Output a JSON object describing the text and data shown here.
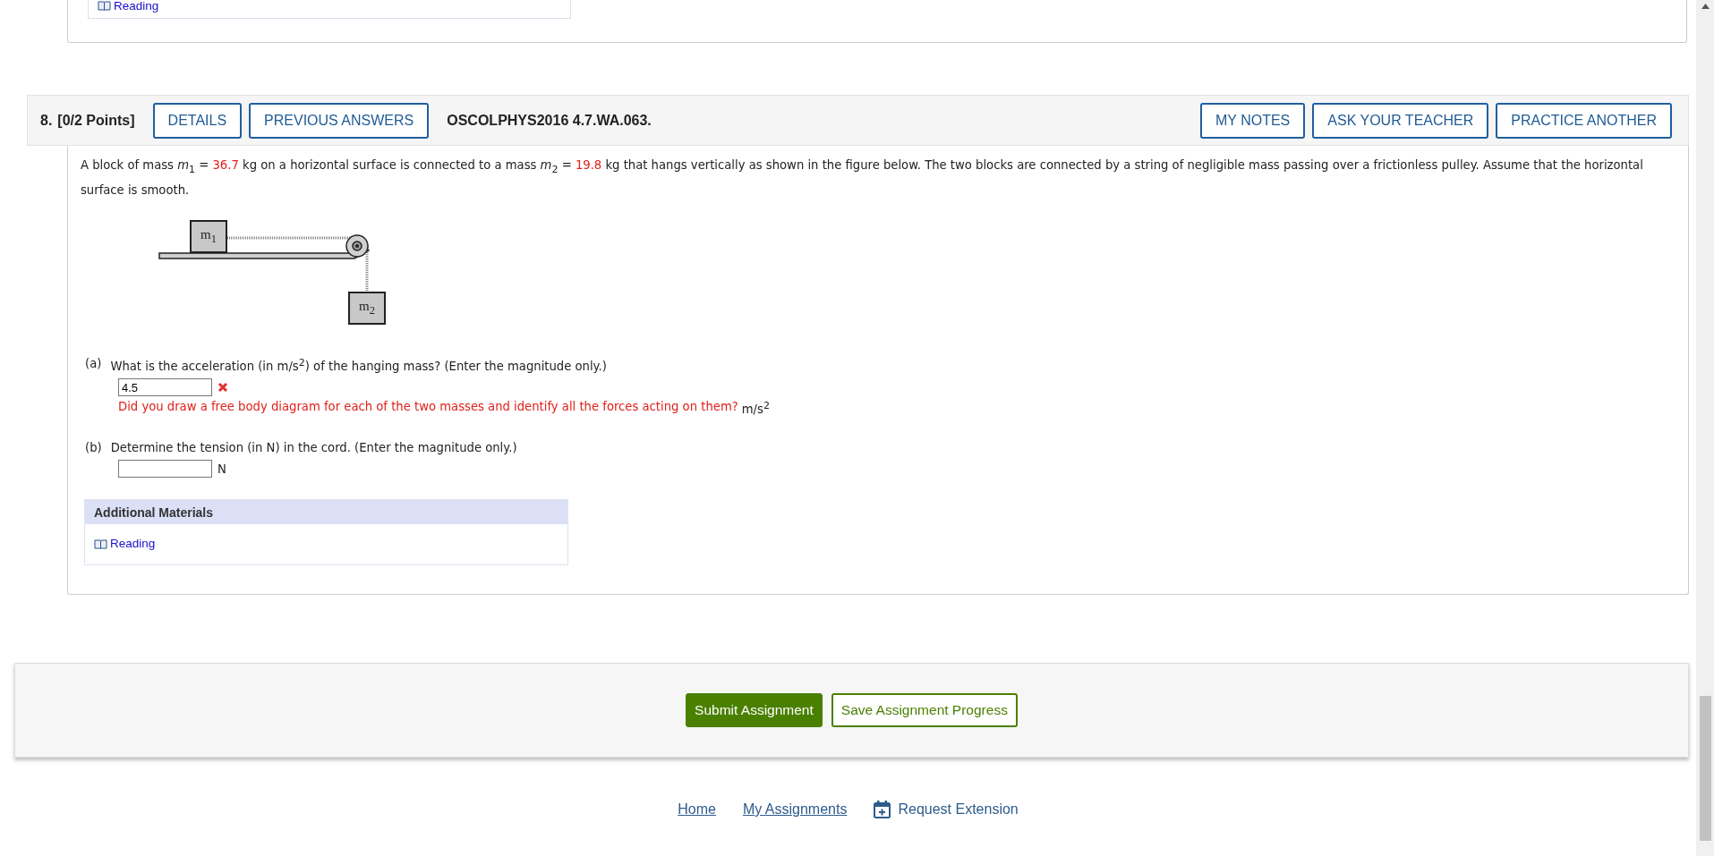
{
  "previous_question": {
    "materials_link": "Reading"
  },
  "question": {
    "number": "8.",
    "points": "[0/2 Points]",
    "buttons_left": [
      "DETAILS",
      "PREVIOUS ANSWERS"
    ],
    "code": "OSCOLPHYS2016 4.7.WA.063.",
    "buttons_right": [
      "MY NOTES",
      "ASK YOUR TEACHER",
      "PRACTICE ANOTHER"
    ],
    "statement": [
      {
        "kind": "text",
        "s": "A block of mass *m*$_{1}$ = "
      },
      {
        "kind": "value",
        "s": "36.7"
      },
      {
        "kind": "text",
        "s": " kg on a horizontal surface is connected to a mass *m*$_{2}$ = "
      },
      {
        "kind": "value",
        "s": "19.8"
      },
      {
        "kind": "text",
        "s": " kg that hangs vertically as shown in the figure below. The two blocks are connected by a string of negligible mass passing over a frictionless pulley. Assume that the horizontal surface is smooth."
      }
    ],
    "figure": {
      "block_1": "m$_{1}$",
      "block_2": "m$_{2}$"
    },
    "parts": [
      {
        "label": "(a)",
        "prompt": "What is the acceleration (in m/s$^{2}$) of the hanging mass? (Enter the magnitude only.)",
        "value": "4.5",
        "correct": false,
        "feedback": "Did you draw a free body diagram for each of the two masses and identify all the forces acting on them?",
        "unit": "m/s$^{2}$"
      },
      {
        "label": "(b)",
        "prompt": "Determine the tension (in N) in the cord. (Enter the magnitude only.)",
        "unit": "N"
      }
    ],
    "additional_materials": {
      "title": "Additional Materials",
      "links": [
        "Reading"
      ]
    }
  },
  "actions": [
    {
      "label": "Submit Assignment",
      "kind": "primary"
    },
    {
      "label": "Save Assignment Progress",
      "kind": "secondary"
    }
  ],
  "footer_links": [
    {
      "label": "Home",
      "kind": "link"
    },
    {
      "label": "My Assignments",
      "kind": "link"
    },
    {
      "label": "Request Extension",
      "kind": "icon-link"
    }
  ]
}
